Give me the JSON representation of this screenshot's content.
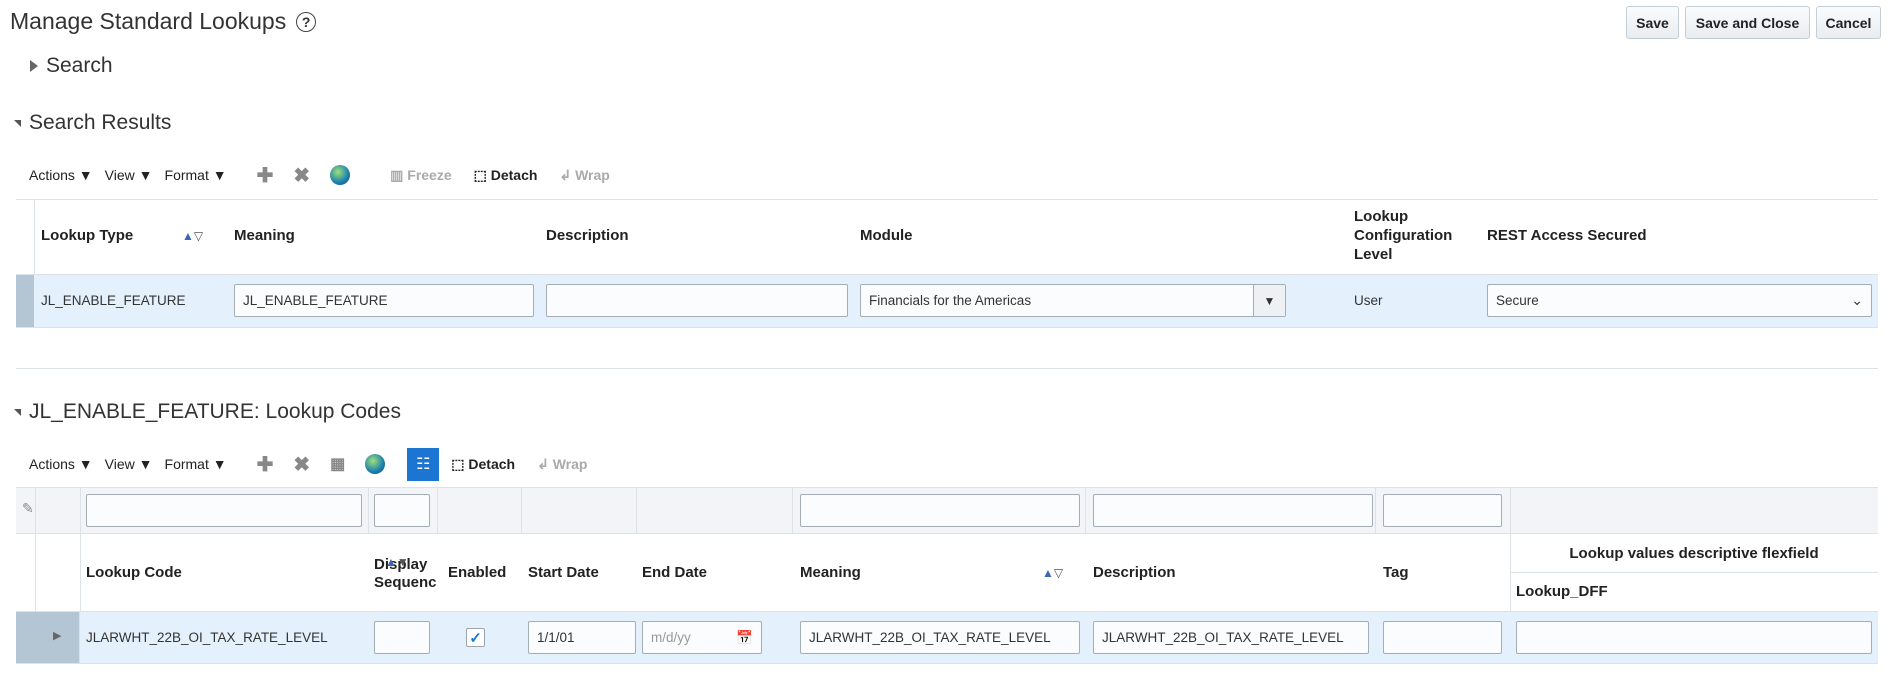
{
  "page": {
    "title": "Manage Standard Lookups",
    "help_icon": "question-circle-icon"
  },
  "buttons": {
    "save": "Save",
    "save_close": "Save and Close",
    "cancel": "Cancel"
  },
  "search": {
    "label": "Search"
  },
  "results": {
    "label": "Search Results",
    "toolbar": {
      "actions": "Actions",
      "view": "View",
      "format": "Format",
      "freeze": "Freeze",
      "detach": "Detach",
      "wrap": "Wrap"
    },
    "columns": [
      "Lookup Type",
      "Meaning",
      "Description",
      "Module",
      "Lookup Configuration Level",
      "REST Access Secured"
    ],
    "row": {
      "lookup_type": "JL_ENABLE_FEATURE",
      "meaning": "JL_ENABLE_FEATURE",
      "description": "",
      "module": "Financials for the Americas",
      "config_level": "User",
      "rest_access": "Secure"
    }
  },
  "codes": {
    "label": "JL_ENABLE_FEATURE: Lookup Codes",
    "toolbar": {
      "actions": "Actions",
      "view": "View",
      "format": "Format",
      "detach": "Detach",
      "wrap": "Wrap"
    },
    "columns": [
      "Lookup Code",
      "Display Sequence",
      "Enabled",
      "Start Date",
      "End Date",
      "Meaning",
      "Description",
      "Tag"
    ],
    "flex_group": "Lookup values descriptive flexfield",
    "flex_col": "Lookup_DFF",
    "row": {
      "lookup_code": "JLARWHT_22B_OI_TAX_RATE_LEVEL",
      "display_sequence": "",
      "enabled": true,
      "start_date": "1/1/01",
      "end_date_placeholder": "m/d/yy",
      "meaning": "JLARWHT_22B_OI_TAX_RATE_LEVEL",
      "description": "JLARWHT_22B_OI_TAX_RATE_LEVEL",
      "tag": "",
      "lookup_dff": ""
    }
  },
  "colors": {
    "row_selected": "#e4f0fb",
    "selector": "#b4c5d3",
    "accent": "#1c75d0"
  }
}
